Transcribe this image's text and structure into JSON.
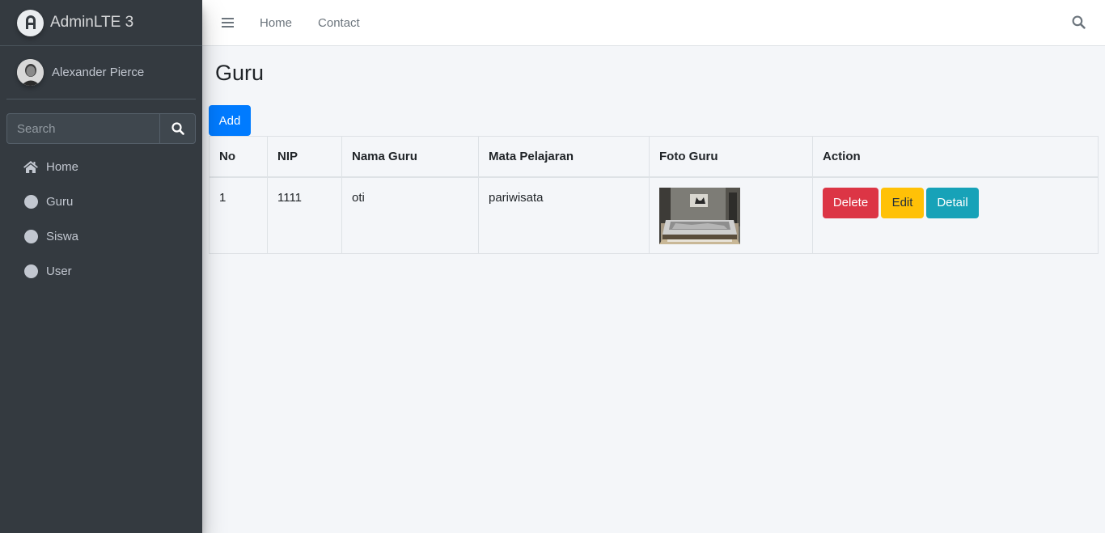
{
  "brand": {
    "title": "AdminLTE 3"
  },
  "user": {
    "name": "Alexander Pierce"
  },
  "sidebar": {
    "search_placeholder": "Search",
    "items": [
      {
        "label": "Home",
        "icon": "home-icon"
      },
      {
        "label": "Guru",
        "icon": "circle-icon"
      },
      {
        "label": "Siswa",
        "icon": "circle-icon"
      },
      {
        "label": "User",
        "icon": "circle-icon"
      }
    ]
  },
  "topbar": {
    "links": [
      "Home",
      "Contact"
    ]
  },
  "page": {
    "title": "Guru",
    "add_label": "Add"
  },
  "table": {
    "headers": [
      "No",
      "NIP",
      "Nama Guru",
      "Mata Pelajaran",
      "Foto Guru",
      "Action"
    ],
    "rows": [
      {
        "no": "1",
        "nip": "1111",
        "nama": "oti",
        "mapel": "pariwisata"
      }
    ],
    "actions": {
      "delete": "Delete",
      "edit": "Edit",
      "detail": "Detail"
    }
  },
  "colors": {
    "sidebar_bg": "#343a40",
    "primary": "#007bff",
    "danger": "#dc3545",
    "warning": "#ffc107",
    "info": "#17a2b8"
  }
}
